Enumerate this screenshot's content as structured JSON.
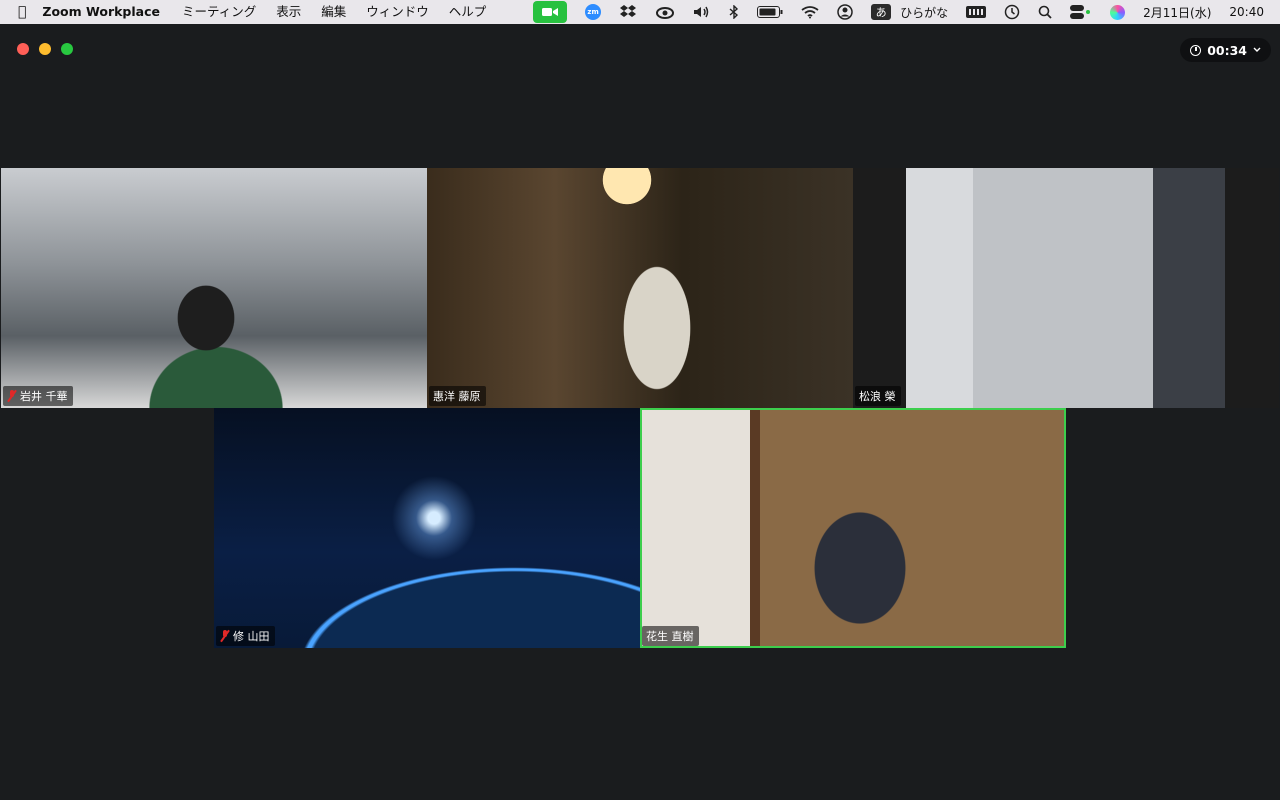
{
  "menubar": {
    "app_name": "Zoom Workplace",
    "items": [
      "ミーティング",
      "表示",
      "編集",
      "ウィンドウ",
      "ヘルプ"
    ],
    "ime_indicator": "あ",
    "ime_label": "ひらがな",
    "date": "2月11日(水)",
    "time": "20:40"
  },
  "window": {
    "timer": "00:34"
  },
  "participants": [
    {
      "name": "岩井 千華",
      "muted": true
    },
    {
      "name": "惠洋 藤原",
      "muted": false
    },
    {
      "name": "松浪 榮",
      "muted": false
    },
    {
      "name": "修 山田",
      "muted": true
    },
    {
      "name": "花生 直樹",
      "muted": false,
      "active_speaker": true
    }
  ],
  "colors": {
    "active_speaker_border": "#3dce4d",
    "muted_mic": "#e02828",
    "zoom_status_green": "#27c13f"
  }
}
